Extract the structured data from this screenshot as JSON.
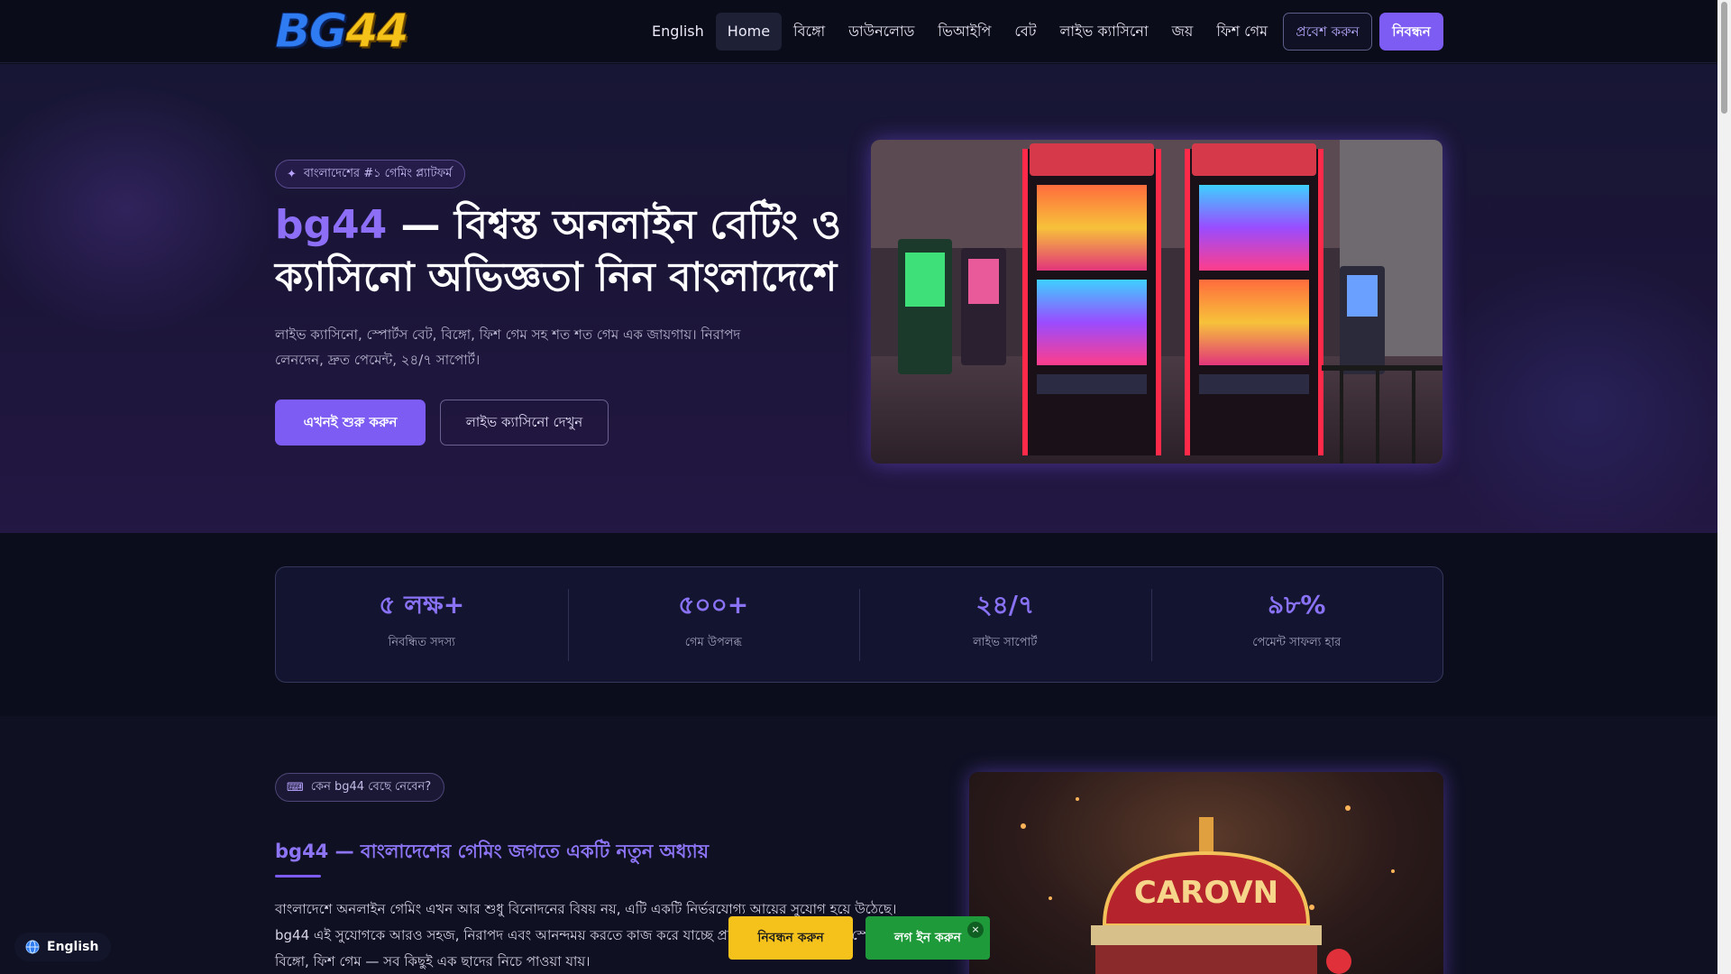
{
  "nav": {
    "logo_part1": "BG",
    "logo_part2": "44",
    "links": [
      {
        "label": "English",
        "active": false
      },
      {
        "label": "Home",
        "active": true
      },
      {
        "label": "বিঙ্গো",
        "active": false
      },
      {
        "label": "ডাউনলোড",
        "active": false
      },
      {
        "label": "ভিআইপি",
        "active": false
      },
      {
        "label": "বেট",
        "active": false
      },
      {
        "label": "লাইভ ক্যাসিনো",
        "active": false
      },
      {
        "label": "জয়",
        "active": false
      },
      {
        "label": "ফিশ গেম",
        "active": false
      }
    ],
    "login_label": "প্রবেশ করুন",
    "register_label": "নিবন্ধন"
  },
  "hero": {
    "badge": "বাংলাদেশের #১ গেমিং প্ল্যাটফর্ম",
    "badge_icon": "sparkle-icon",
    "title_brand": "bg44",
    "title_rest": " — বিশ্বস্ত অনলাইন বেটিং ও ক্যাসিনো অভিজ্ঞতা নিন বাংলাদেশে",
    "description": "লাইভ ক্যাসিনো, স্পোর্টস বেট, বিঙ্গো, ফিশ গেম সহ শত শত গেম এক জায়গায়। নিরাপদ লেনদেন, দ্রুত পেমেন্ট, ২৪/৭ সাপোর্ট।",
    "start_button": "এখনই শুরু করুন",
    "live_button": "লাইভ ক্যাসিনো দেখুন"
  },
  "stats": [
    {
      "value": "৫ লক্ষ+",
      "label": "নিবন্ধিত সদস্য"
    },
    {
      "value": "৫০০+",
      "label": "গেম উপলব্ধ"
    },
    {
      "value": "২৪/৭",
      "label": "লাইভ সাপোর্ট"
    },
    {
      "value": "৯৮%",
      "label": "পেমেন্ট সাফল্য হার"
    }
  ],
  "why": {
    "badge": "কেন bg44 বেছে নেবেন?",
    "badge_icon": "gamepad-icon",
    "title": "bg44 — বাংলাদেশের গেমিং জগতে একটি নতুন অধ্যায়",
    "text": "বাংলাদেশে অনলাইন গেমিং এখন আর শুধু বিনোদনের বিষয় নয়, এটি একটি নির্ভরযোগ্য আয়ের সুযোগ হয়ে উঠেছে। bg44 এই সুযোগকে আরও সহজ, নিরাপদ এবং আনন্দময় করতে কাজ করে যাচ্ছে প্রতিনিয়ত। আমা... করে স্পোর্টস বেটিং, বিঙ্গো, ফিশ গেম — সব কিছুই এক ছাদের নিচে পাওয়া যায়।",
    "image_sign": "CAROVN"
  },
  "floating": {
    "language": "English",
    "language_icon": "globe-icon",
    "register_label": "নিবন্ধন করুন",
    "login_label": "লগ ইন করুন",
    "close_glyph": "×"
  },
  "colors": {
    "accent": "#7c5cf2",
    "brand_purple": "#8c6ff6",
    "register_yellow": "#f4c21b",
    "login_green": "#1f9a3a"
  }
}
